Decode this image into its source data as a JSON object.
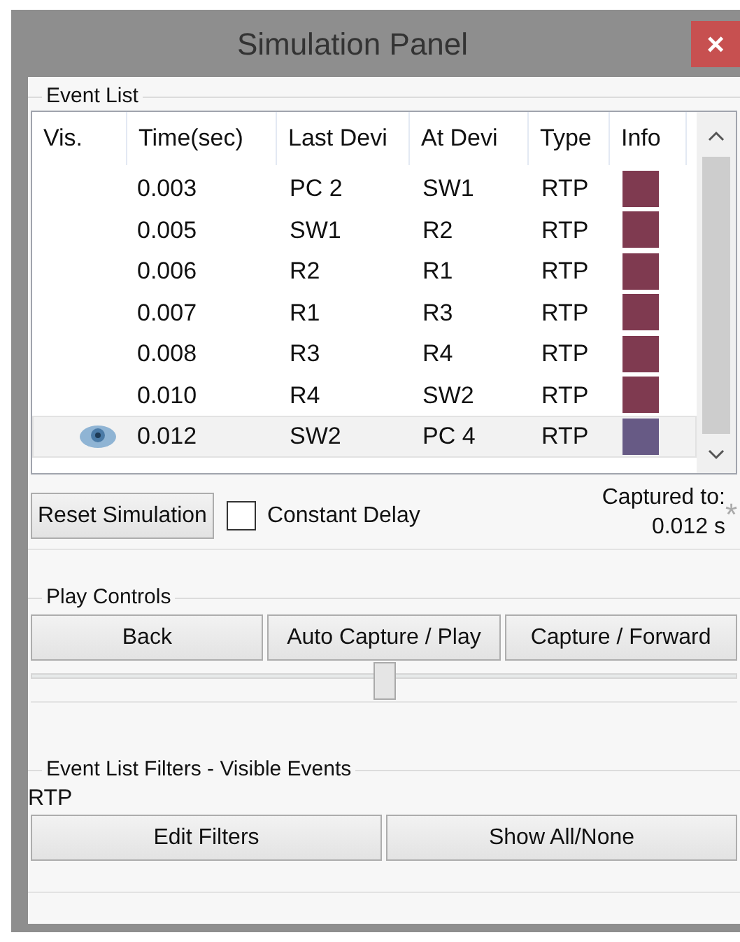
{
  "window": {
    "title": "Simulation Panel",
    "close": "×"
  },
  "event_list": {
    "title": "Event List",
    "columns": [
      "Vis.",
      "Time(sec)",
      "Last Devi",
      "At Devi",
      "Type",
      "Info"
    ],
    "rows": [
      {
        "visible": false,
        "selected": false,
        "time": "0.003",
        "last_device": "PC 2",
        "at_device": "SW1",
        "type": "RTP",
        "color": "#7f3a50"
      },
      {
        "visible": false,
        "selected": false,
        "time": "0.005",
        "last_device": "SW1",
        "at_device": "R2",
        "type": "RTP",
        "color": "#7f3a50"
      },
      {
        "visible": false,
        "selected": false,
        "time": "0.006",
        "last_device": "R2",
        "at_device": "R1",
        "type": "RTP",
        "color": "#7f3a50"
      },
      {
        "visible": false,
        "selected": false,
        "time": "0.007",
        "last_device": "R1",
        "at_device": "R3",
        "type": "RTP",
        "color": "#7f3a50"
      },
      {
        "visible": false,
        "selected": false,
        "time": "0.008",
        "last_device": "R3",
        "at_device": "R4",
        "type": "RTP",
        "color": "#7f3a50"
      },
      {
        "visible": false,
        "selected": false,
        "time": "0.010",
        "last_device": "R4",
        "at_device": "SW2",
        "type": "RTP",
        "color": "#7f3a50"
      },
      {
        "visible": true,
        "selected": true,
        "time": "0.012",
        "last_device": "SW2",
        "at_device": "PC 4",
        "type": "RTP",
        "color": "#675a85"
      }
    ]
  },
  "reset_button": "Reset Simulation",
  "constant_delay": {
    "label": "Constant Delay",
    "checked": false
  },
  "captured": {
    "label": "Captured to:",
    "value": "0.012 s",
    "marker": "*"
  },
  "play_controls": {
    "title": "Play Controls",
    "buttons": [
      "Back",
      "Auto Capture / Play",
      "Capture / Forward"
    ],
    "slider": {
      "level": 0.5
    }
  },
  "filters": {
    "title": "Event List Filters - Visible Events",
    "active": "RTP",
    "buttons": [
      "Edit Filters",
      "Show All/None"
    ]
  }
}
